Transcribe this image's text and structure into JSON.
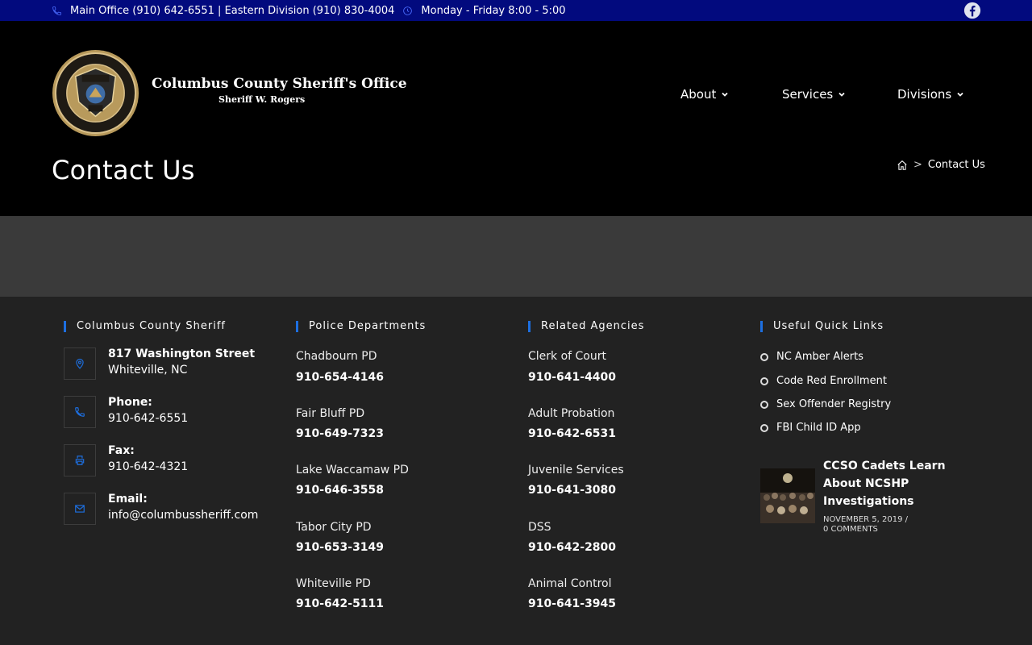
{
  "topbar": {
    "phones": "Main Office (910) 642-6551 | Eastern Division (910) 830-4004",
    "hours": "Monday - Friday 8:00 - 5:00",
    "accent": "#020a7e"
  },
  "header": {
    "title": "Columbus County Sheriff's Office",
    "subtitle": "Sheriff W. Rogers",
    "logo_text": {
      "top": "DEDICATED TO SERVE",
      "bottom": "INTEGRITY · HONOR · SERVICE",
      "badge": "SHERIFF",
      "state": "NC"
    },
    "nav": [
      {
        "label": "About"
      },
      {
        "label": "Services"
      },
      {
        "label": "Divisions"
      }
    ]
  },
  "page": {
    "title": "Contact Us",
    "breadcrumb": {
      "current": "Contact Us",
      "separator": ">"
    }
  },
  "footer": {
    "accent": "#1d6fe0",
    "col1": {
      "title": "Columbus County Sheriff",
      "address_line1": "817 Washington Street",
      "address_line2": "Whiteville, NC",
      "phone_label": "Phone:",
      "phone": "910-642-6551",
      "fax_label": "Fax:",
      "fax": "910-642-4321",
      "email_label": "Email:",
      "email": "info@columbussheriff.com"
    },
    "col2": {
      "title": "Police Departments",
      "items": [
        {
          "name": "Chadbourn PD",
          "phone": "910-654-4146"
        },
        {
          "name": "Fair Bluff PD",
          "phone": "910-649-7323"
        },
        {
          "name": "Lake Waccamaw PD",
          "phone": "910-646-3558"
        },
        {
          "name": "Tabor City PD",
          "phone": "910-653-3149"
        },
        {
          "name": "Whiteville PD",
          "phone": "910-642-5111"
        }
      ]
    },
    "col3": {
      "title": "Related Agencies",
      "items": [
        {
          "name": "Clerk of Court",
          "phone": "910-641-4400"
        },
        {
          "name": "Adult Probation",
          "phone": "910-642-6531"
        },
        {
          "name": "Juvenile Services",
          "phone": "910-641-3080"
        },
        {
          "name": "DSS",
          "phone": "910-642-2800"
        },
        {
          "name": "Animal Control",
          "phone": "910-641-3945"
        }
      ]
    },
    "col4": {
      "title": "Useful Quick Links",
      "links": [
        {
          "label": "NC Amber Alerts"
        },
        {
          "label": "Code Red Enrollment"
        },
        {
          "label": "Sex Offender Registry"
        },
        {
          "label": "FBI Child ID App"
        }
      ],
      "post": {
        "title": "CCSO Cadets Learn About NCSHP Investigations",
        "date": "NOVEMBER 5, 2019 /",
        "comments": "0 COMMENTS"
      }
    }
  }
}
